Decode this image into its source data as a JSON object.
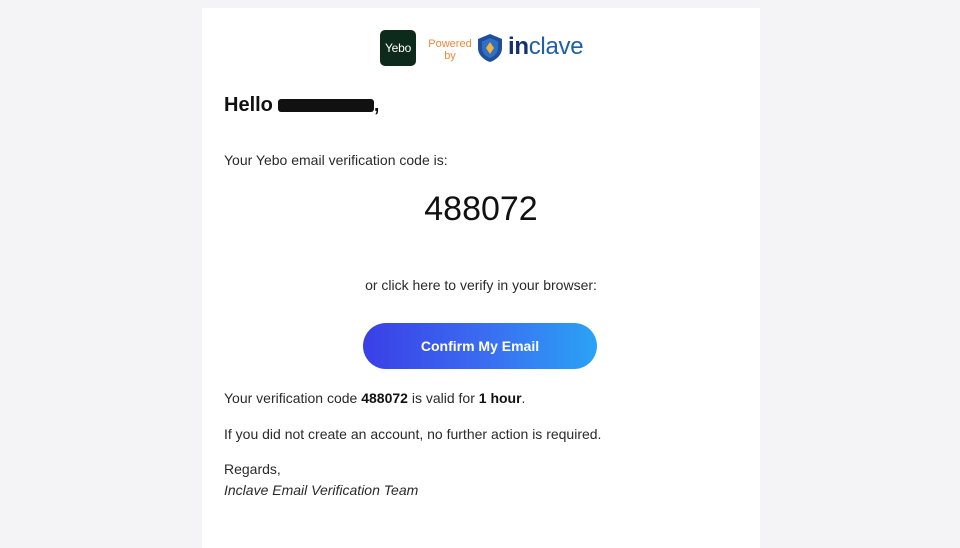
{
  "header": {
    "yebo_logo_text": "Yebo",
    "powered_line1": "Powered",
    "powered_line2": "by",
    "inclave_bold": "in",
    "inclave_rest": "clave",
    "colors": {
      "yebo_bg": "#0e2a1a",
      "powered": "#f0883a",
      "inclave_dark": "#13316b",
      "inclave_light": "#1f5fa8",
      "shield_gold": "#f2b33d"
    }
  },
  "email": {
    "greeting": "Hello",
    "greeting_suffix": ",",
    "intro": "Your Yebo email verification code is:",
    "code": "488072",
    "or_click": "or click here to verify in your browser:",
    "confirm_button": "Confirm My Email",
    "validity": {
      "prefix": "Your verification code ",
      "code": "488072",
      "middle": " is valid for ",
      "duration": "1 hour",
      "suffix": "."
    },
    "no_action": "If you did not create an account, no further action is required.",
    "regards": "Regards,",
    "team": "Inclave Email Verification Team"
  },
  "colors": {
    "button_gradient_start": "#3a3fe6",
    "button_gradient_end": "#2aa3f5",
    "page_bg": "#f4f4f6"
  }
}
